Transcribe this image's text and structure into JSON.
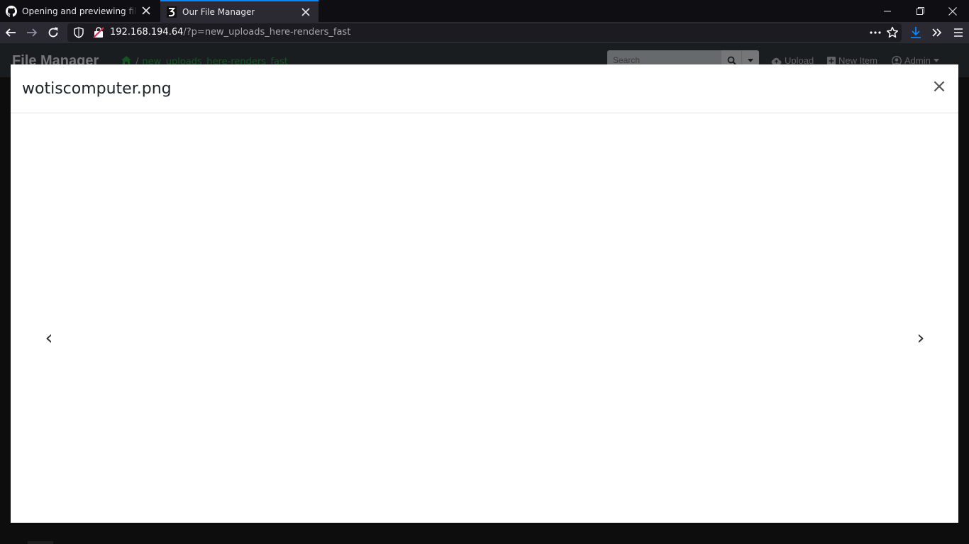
{
  "browser": {
    "tabs": [
      {
        "title": "Opening and previewing files n",
        "icon": "github-icon",
        "active": false
      },
      {
        "title": "Our File Manager",
        "icon": "site-favicon-icon",
        "active": true
      }
    ],
    "url": {
      "host": "192.168.194.64",
      "path": "/?p=new_uploads_here-renders_fast"
    },
    "accent_color": "#0a84ff"
  },
  "app": {
    "brand": "File Manager",
    "breadcrumb": {
      "separator": "/",
      "current": "new_uploads_here-renders_fast"
    },
    "search": {
      "placeholder": "Search"
    },
    "actions": {
      "upload": "Upload",
      "new_item": "New Item",
      "user": "Admin"
    }
  },
  "modal": {
    "title": "wotiscomputer.png",
    "close": "×",
    "prev": "‹",
    "next": "›"
  }
}
